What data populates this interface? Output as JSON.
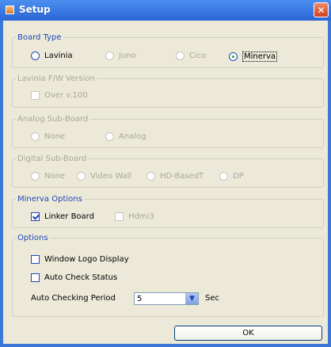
{
  "window": {
    "title": "Setup",
    "close_glyph": "✕"
  },
  "board_type": {
    "legend": "Board Type",
    "options": [
      {
        "label": "Lavinia",
        "enabled": true,
        "checked": false
      },
      {
        "label": "Juno",
        "enabled": false,
        "checked": false
      },
      {
        "label": "Cico",
        "enabled": false,
        "checked": false
      },
      {
        "label": "Minerva",
        "enabled": true,
        "checked": true
      }
    ]
  },
  "lavinia_fw": {
    "legend": "Lavinia F/W Version",
    "checkbox_label": "Over v.100"
  },
  "analog_sub": {
    "legend": "Analog Sub-Board",
    "options": [
      "None",
      "Analog"
    ]
  },
  "digital_sub": {
    "legend": "Digital Sub-Board",
    "options": [
      "None",
      "Video Wall",
      "HD-BasedT",
      "DP"
    ]
  },
  "minerva_options": {
    "legend": "Minerva Options",
    "items": [
      {
        "label": "Linker Board",
        "checked": true,
        "enabled": true
      },
      {
        "label": "Hdmi3",
        "checked": false,
        "enabled": false
      }
    ]
  },
  "options": {
    "legend": "Options",
    "window_logo_label": "Window Logo Display",
    "auto_check_label": "Auto Check Status",
    "period_label": "Auto Checking Period",
    "period_value": "5",
    "unit_label": "Sec"
  },
  "buttons": {
    "ok": "OK"
  },
  "colors": {
    "title_bar": "#2a66d6",
    "dialog_face": "#ece9d8",
    "accent": "#1f48b8",
    "disabled": "#a7a79a"
  }
}
